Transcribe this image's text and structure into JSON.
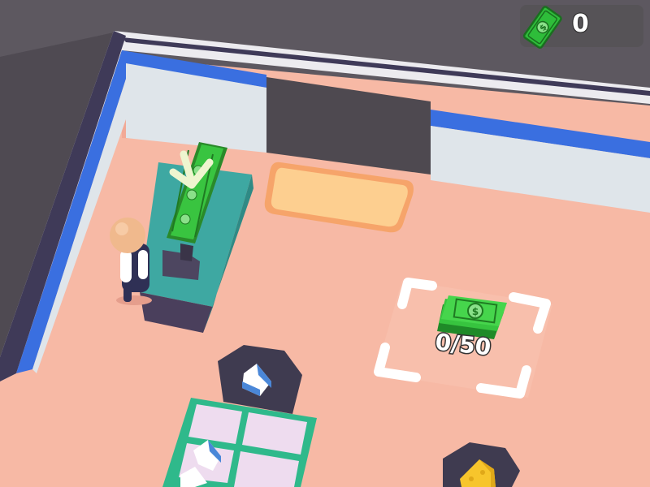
{
  "hud": {
    "money_icon": "cash-bill-icon",
    "money_amount": "0"
  },
  "cash_drop_zone": {
    "progress": "0/50",
    "icon": "cash-stack-icon"
  },
  "stations": [
    {
      "icon": "milk-carton-icon"
    },
    {
      "icon": "cheese-icon"
    }
  ],
  "colors": {
    "floor": "#f7b9a5",
    "wall": "#dfe5ea",
    "wall_trim": "#3a6fe0",
    "counter": "#3ea8a2",
    "cash": "#2ebd3a",
    "shelf": "#2fb98b",
    "background": "#5d5860"
  }
}
